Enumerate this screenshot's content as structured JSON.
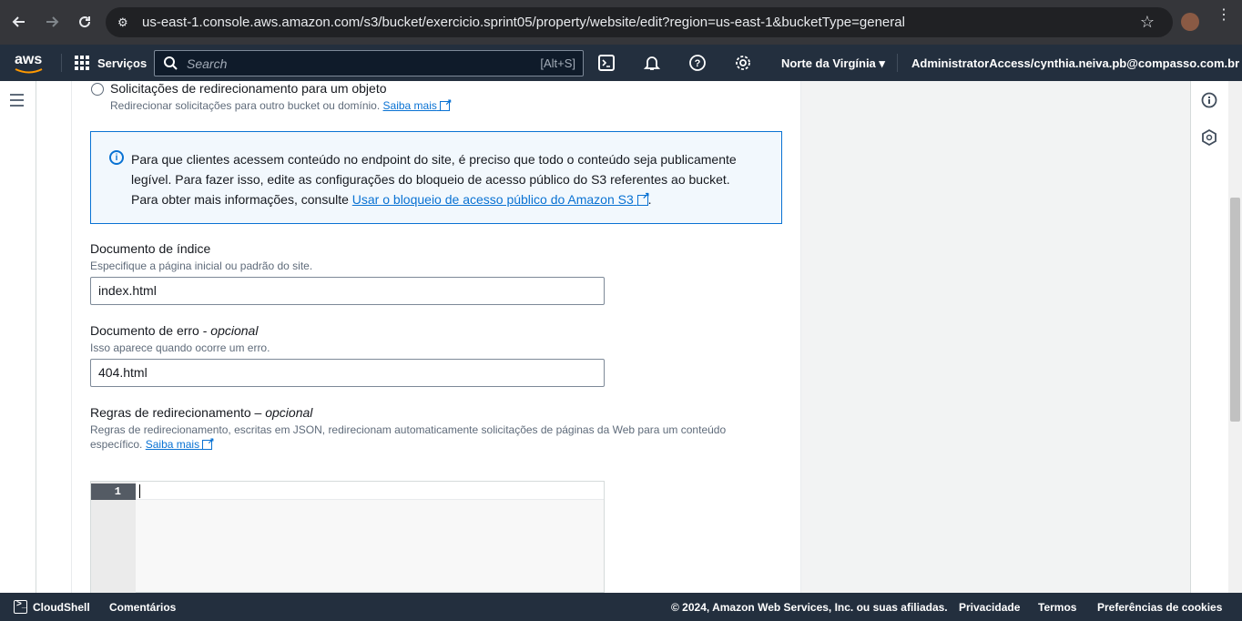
{
  "browser": {
    "url": "us-east-1.console.aws.amazon.com/s3/bucket/exercicio.sprint05/property/website/edit?region=us-east-1&bucketType=general"
  },
  "aws_nav": {
    "logo": "aws",
    "services": "Serviços",
    "search_placeholder": "Search",
    "search_shortcut": "[Alt+S]",
    "region": "Norte da Virgínia",
    "account": "AdministratorAccess/cynthia.neiva.pb@compasso.com.br"
  },
  "redirect_option": {
    "label": "Solicitações de redirecionamento para um objeto",
    "description": "Redirecionar solicitações para outro bucket ou domínio.",
    "link": "Saiba mais"
  },
  "info_alert": {
    "line1": "Para que clientes acessem conteúdo no endpoint do site, é preciso que todo o conteúdo seja publicamente",
    "line2": "legível. Para fazer isso, edite as configurações do bloqueio de acesso público do S3 referentes ao bucket.",
    "line3_prefix": "Para obter mais informações, consulte ",
    "line3_link": "Usar o bloqueio de acesso público do Amazon S3",
    "line3_suffix": "."
  },
  "index_document": {
    "label": "Documento de índice",
    "description": "Especifique a página inicial ou padrão do site.",
    "value": "index.html"
  },
  "error_document": {
    "label": "Documento de erro - ",
    "label_optional": "opcional",
    "description": "Isso aparece quando ocorre um erro.",
    "value": "404.html"
  },
  "redirect_rules": {
    "label": "Regras de redirecionamento – ",
    "label_optional": "opcional",
    "description_line1": "Regras de redirecionamento, escritas em JSON, redirecionam automaticamente solicitações de páginas da Web para um conteúdo",
    "description_line2": "específico.",
    "link": "Saiba mais",
    "editor_line_number": "1"
  },
  "footer": {
    "cloudshell": "CloudShell",
    "comments": "Comentários",
    "copyright": "© 2024, Amazon Web Services, Inc. ou suas afiliadas.",
    "privacy": "Privacidade",
    "terms": "Termos",
    "cookies": "Preferências de cookies"
  },
  "colors": {
    "aws_nav_bg": "#232f3e",
    "link_blue": "#0972d3",
    "info_bg": "#f2f8fd"
  }
}
